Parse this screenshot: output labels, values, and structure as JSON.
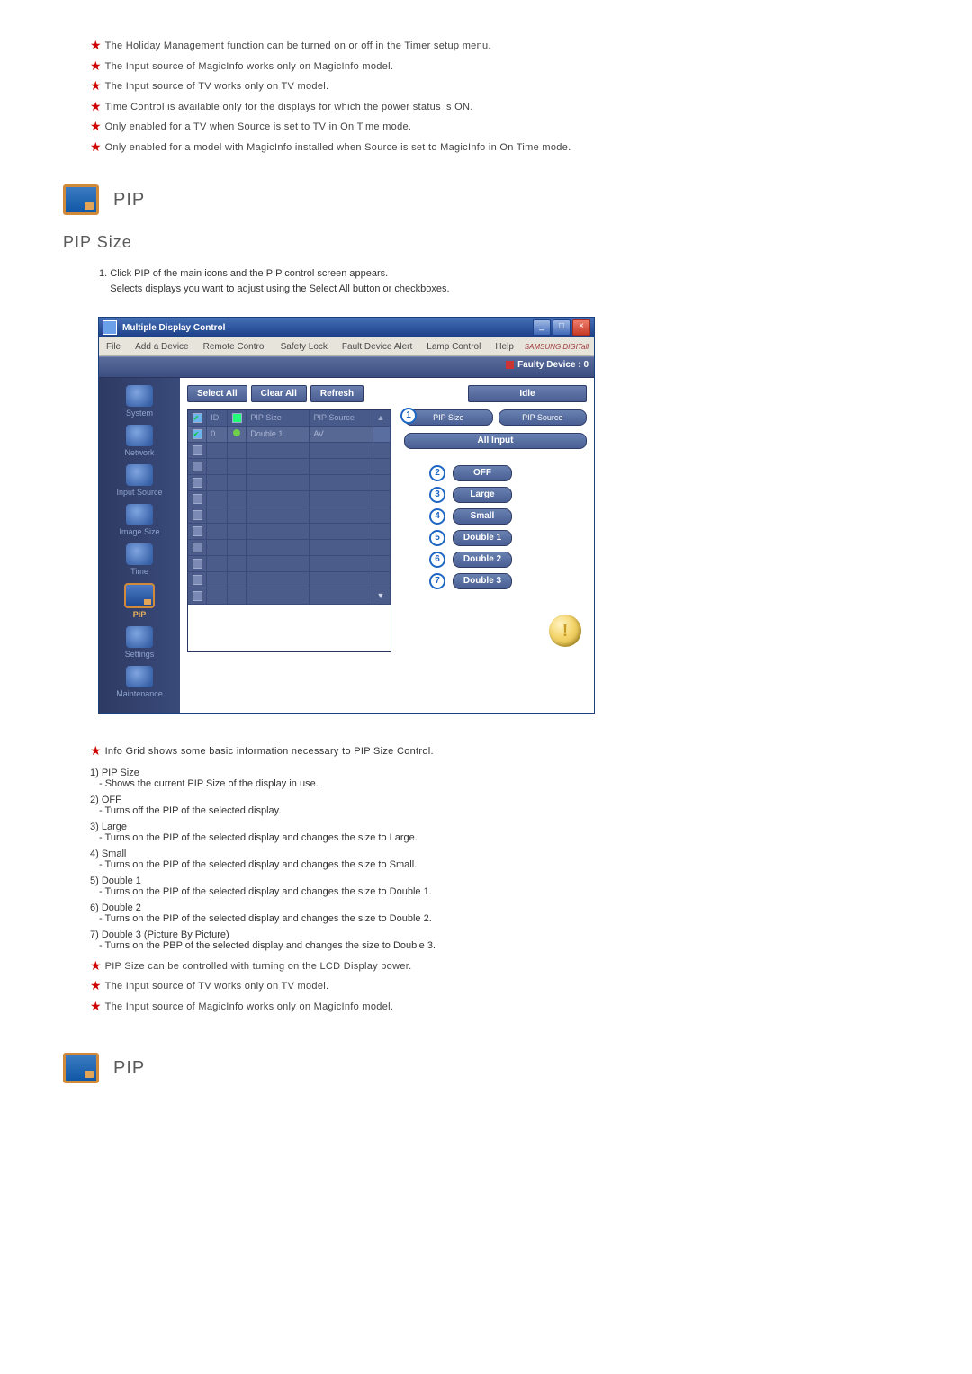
{
  "top_notes": [
    "The Holiday Management function can be turned on or off in the Timer setup menu.",
    "The Input source of MagicInfo works only on MagicInfo model.",
    "The Input source of TV works only on TV model.",
    "Time Control is available only for the displays for which the power status is ON.",
    "Only enabled for a TV when Source is set to TV in On Time mode.",
    "Only enabled for a model with MagicInfo installed when Source is set to MagicInfo in On Time mode."
  ],
  "pip_heading": "PIP",
  "section_pip_size": "PIP Size",
  "intro": {
    "num": "1.",
    "line1": "Click PIP of the main icons and the PIP control screen appears.",
    "line2": "Selects displays you want to adjust using the Select All button or checkboxes."
  },
  "window": {
    "title": "Multiple Display Control",
    "menu": [
      "File",
      "Add a Device",
      "Remote Control",
      "Safety Lock",
      "Fault Device Alert",
      "Lamp Control",
      "Help"
    ],
    "brand": "SAMSUNG DIGITall",
    "faulty_label": "Faulty Device : 0",
    "sidebar": [
      {
        "label": "System"
      },
      {
        "label": "Network"
      },
      {
        "label": "Input Source"
      },
      {
        "label": "Image Size"
      },
      {
        "label": "Time"
      },
      {
        "label": "PiP",
        "active": true
      },
      {
        "label": "Settings"
      },
      {
        "label": "Maintenance"
      }
    ],
    "toolbar": {
      "select_all": "Select All",
      "clear_all": "Clear All",
      "refresh": "Refresh",
      "idle": "Idle"
    },
    "grid": {
      "headers": {
        "id": "ID",
        "pip_size": "PIP Size",
        "pip_source": "PIP Source"
      },
      "row": {
        "id": "0",
        "pip_size": "Double 1",
        "pip_source": "AV"
      }
    },
    "right": {
      "pip_size_hdr": "PIP Size",
      "pip_source_hdr": "PIP Source",
      "all_input": "All Input",
      "options": [
        {
          "n": "2",
          "label": "OFF"
        },
        {
          "n": "3",
          "label": "Large"
        },
        {
          "n": "4",
          "label": "Small"
        },
        {
          "n": "5",
          "label": "Double 1"
        },
        {
          "n": "6",
          "label": "Double 2"
        },
        {
          "n": "7",
          "label": "Double 3"
        }
      ],
      "callout1": "1",
      "warn_mark": "!"
    }
  },
  "info_note": "Info Grid shows some basic information necessary to PIP Size Control.",
  "items": [
    {
      "n": "1)",
      "title": "PIP Size",
      "desc": "- Shows the current PIP Size of the display in use."
    },
    {
      "n": "2)",
      "title": "OFF",
      "desc": "- Turns off the PIP of the selected display."
    },
    {
      "n": "3)",
      "title": "Large",
      "desc": "- Turns on the PIP of the selected display and changes the size to Large."
    },
    {
      "n": "4)",
      "title": "Small",
      "desc": "- Turns on the PIP of the selected display and changes the size to Small."
    },
    {
      "n": "5)",
      "title": "Double 1",
      "desc": "- Turns on the PIP of the selected display and changes the size to Double 1."
    },
    {
      "n": "6)",
      "title": "Double 2",
      "desc": "- Turns on the PIP of the selected display and changes the size to Double 2."
    },
    {
      "n": "7)",
      "title": "Double 3 (Picture By Picture)",
      "desc": "- Turns on the PBP of the selected display and changes the size to Double 3."
    }
  ],
  "bottom_notes": [
    "PIP Size can be controlled with turning on the LCD Display power.",
    "The Input source of TV works only on TV model.",
    "The Input source of MagicInfo works only on MagicInfo model."
  ],
  "pip_heading_2": "PIP"
}
